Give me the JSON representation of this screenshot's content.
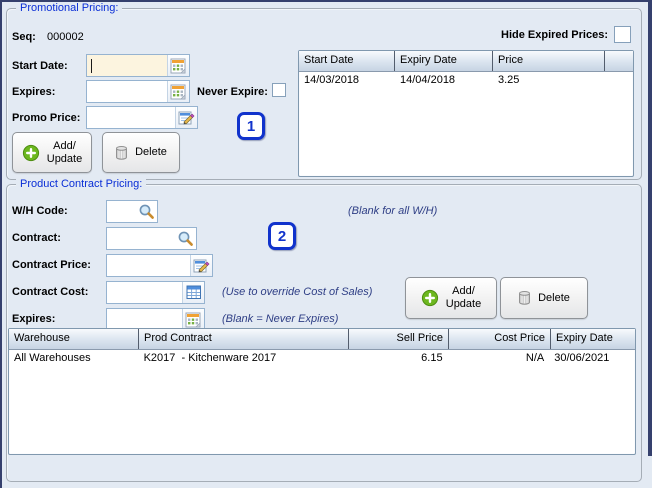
{
  "promo": {
    "title": "Promotional Pricing:",
    "seq_label": "Seq:",
    "seq_value": "000002",
    "start_date_label": "Start Date:",
    "expires_label": "Expires:",
    "never_expire_label": "Never Expire:",
    "promo_price_label": "Promo Price:",
    "hide_expired_label": "Hide Expired Prices:",
    "add_update_line1": "Add/",
    "add_update_line2": "Update",
    "delete_label": "Delete",
    "marker": "1",
    "start_date_value": "",
    "expires_value": "",
    "promo_price_value": "",
    "table": {
      "columns": [
        "Start Date",
        "Expiry Date",
        "Price"
      ],
      "rows": [
        {
          "start": "14/03/2018",
          "expiry": "14/04/2018",
          "price": "3.25"
        }
      ]
    }
  },
  "contract": {
    "title": "Product Contract Pricing:",
    "wh_code_label": "W/H Code:",
    "contract_label": "Contract:",
    "contract_price_label": "Contract Price:",
    "contract_cost_label": "Contract Cost:",
    "expires_label": "Expires:",
    "hint_wh": "(Blank for all W/H)",
    "hint_cost": "(Use to override Cost of Sales)",
    "hint_expires": "(Blank = Never Expires)",
    "add_update_line1": "Add/",
    "add_update_line2": "Update",
    "delete_label": "Delete",
    "marker": "2",
    "wh_code_value": "",
    "contract_value": "",
    "contract_price_value": "",
    "contract_cost_value": "",
    "expires_value": "",
    "table": {
      "columns": [
        "Warehouse",
        "Prod Contract",
        "Sell Price",
        "Cost Price",
        "Expiry Date"
      ],
      "rows": [
        {
          "warehouse": "All Warehouses",
          "prod_contract": "K2017  - Kitchenware 2017",
          "sell_price": "6.15",
          "cost_price": "N/A",
          "expiry_date": "30/06/2021"
        }
      ]
    }
  },
  "icons": {
    "date_picker": "calendar-icon",
    "lookup": "search-icon",
    "price": "edit-price-icon",
    "cost": "grid-icon",
    "add": "plus-icon",
    "delete": "trash-icon"
  },
  "colors": {
    "background": "#e3eaf3",
    "window_edge": "#35406d",
    "group_title": "#0a2ed6",
    "hint_text": "#2e3e85",
    "marker_blue": "#1133cc",
    "field_border": "#96b3d0",
    "focused_field_bg": "#fcf4df",
    "header_gradient_top": "#f8fafd",
    "header_gradient_bottom": "#c7d4e3",
    "add_icon_green": "#6cb71e"
  }
}
